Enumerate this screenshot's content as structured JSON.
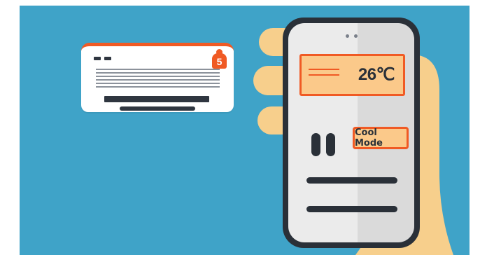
{
  "air_conditioner": {
    "badge": "5"
  },
  "phone": {
    "temperature": "26℃",
    "mode_button": "Cool Mode"
  },
  "colors": {
    "background": "#3fa3c8",
    "accent": "#f05a24",
    "accent_light": "#fbc98a",
    "dark": "#2a3038",
    "skin": "#f7cf8c"
  }
}
